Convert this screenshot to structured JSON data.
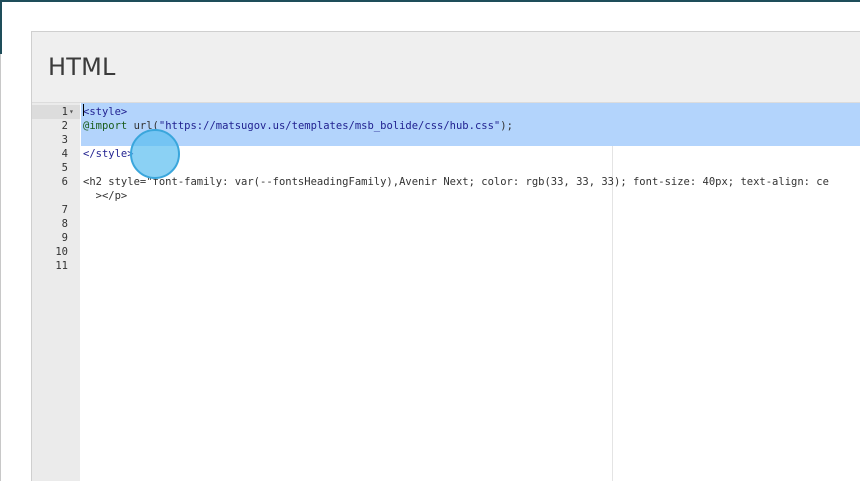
{
  "panel": {
    "title": "HTML"
  },
  "editor": {
    "lines": [
      {
        "num": "1",
        "fold": "▾",
        "parts": [
          {
            "t": "<style>",
            "c": "tag"
          }
        ]
      },
      {
        "num": "2",
        "fold": "",
        "parts": [
          {
            "t": "@import",
            "c": "at"
          },
          {
            "t": " url(",
            "c": ""
          },
          {
            "t": "\"https://matsugov.us/templates/msb_bolide/css/hub.css\"",
            "c": "str"
          },
          {
            "t": ");",
            "c": ""
          }
        ]
      },
      {
        "num": "3",
        "fold": "",
        "parts": []
      },
      {
        "num": "4",
        "fold": "",
        "parts": [
          {
            "t": "</style>",
            "c": "tag"
          }
        ]
      },
      {
        "num": "5",
        "fold": "",
        "parts": []
      },
      {
        "num": "6",
        "fold": "",
        "parts": [
          {
            "t": "<h2 style=\"font-family: var(--fontsHeadingFamily),Avenir Next; color: rgb(33, 33, 33); font-size: 40px; text-align: ce",
            "c": ""
          }
        ]
      },
      {
        "num": "",
        "fold": "",
        "parts": [
          {
            "t": "  ></p>",
            "c": ""
          }
        ]
      },
      {
        "num": "7",
        "fold": "",
        "parts": []
      },
      {
        "num": "8",
        "fold": "",
        "parts": []
      },
      {
        "num": "9",
        "fold": "",
        "parts": []
      },
      {
        "num": "10",
        "fold": "",
        "parts": []
      },
      {
        "num": "11",
        "fold": "",
        "parts": []
      }
    ]
  }
}
